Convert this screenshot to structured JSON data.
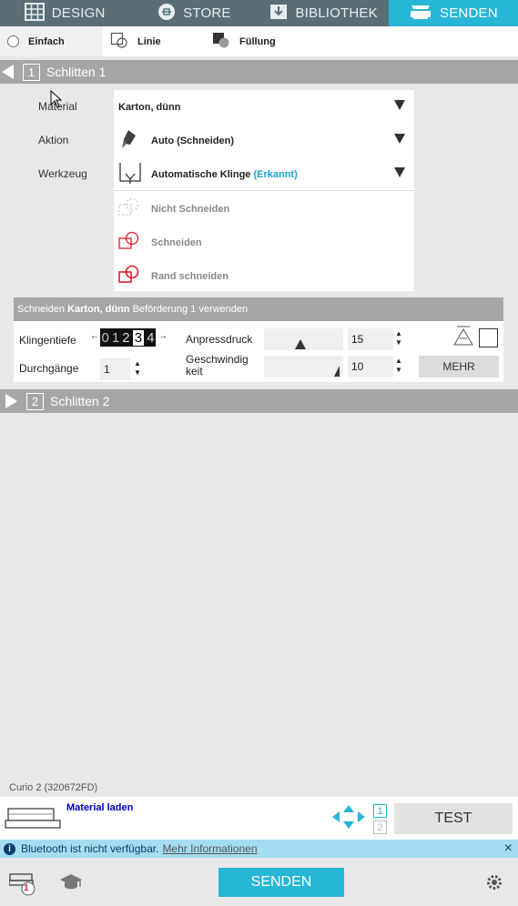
{
  "tabs": [
    {
      "label": "DESIGN",
      "icon": "grid-icon",
      "active": false
    },
    {
      "label": "STORE",
      "icon": "store-icon",
      "active": false
    },
    {
      "label": "BIBLIOTHEK",
      "icon": "library-download-icon",
      "active": false
    },
    {
      "label": "SENDEN",
      "icon": "plotter-icon",
      "active": true
    }
  ],
  "modes": {
    "simple": "Einfach",
    "line": "Linie",
    "fill": "Füllung"
  },
  "carriage1": {
    "number": "1",
    "title": "Schlitten 1",
    "expanded": true
  },
  "carriage2": {
    "number": "2",
    "title": "Schlitten 2",
    "expanded": false
  },
  "material": {
    "label_material": "Material",
    "label_action": "Aktion",
    "label_tool": "Werkzeug",
    "material_value": "Karton, dünn",
    "action_value": "Auto (Schneiden)",
    "tool_value": "Automatische Klinge",
    "tool_detected": "(Erkannt)",
    "options": [
      "Nicht Schneiden",
      "Schneiden",
      "Rand schneiden"
    ]
  },
  "settings": {
    "bar_prefix": "Schneiden",
    "bar_material": "Karton, dünn",
    "bar_suffix": "Beförderung 1 verwenden",
    "blade_depth_label": "Klingentiefe",
    "blade_digits": [
      "0",
      "1",
      "2",
      "3",
      "4"
    ],
    "blade_depth_value": 3,
    "pressure_label": "Anpressdruck",
    "pressure_value": "15",
    "passes_label": "Durchgänge",
    "passes_value": "1",
    "speed_label": "Geschwindigkeit",
    "speed_value": "10",
    "more_label": "MEHR"
  },
  "device": {
    "name": "Curio 2 (320672FD)",
    "load_material": "Material laden",
    "carriage_buttons": [
      "1",
      "2"
    ],
    "test_label": "TEST"
  },
  "bluetooth": {
    "message": "Bluetooth ist nicht verfügbar.",
    "link": "Mehr Informationen",
    "close": "×"
  },
  "footer": {
    "send_label": "SENDEN",
    "badge": "1"
  },
  "colors": {
    "accent": "#28b6d6",
    "header_bg": "#5a6e78",
    "section_bg": "#a6a6a6",
    "link_blue": "#0000cc",
    "detected": "#1aa3d6",
    "cut_red": "#e0202a"
  }
}
